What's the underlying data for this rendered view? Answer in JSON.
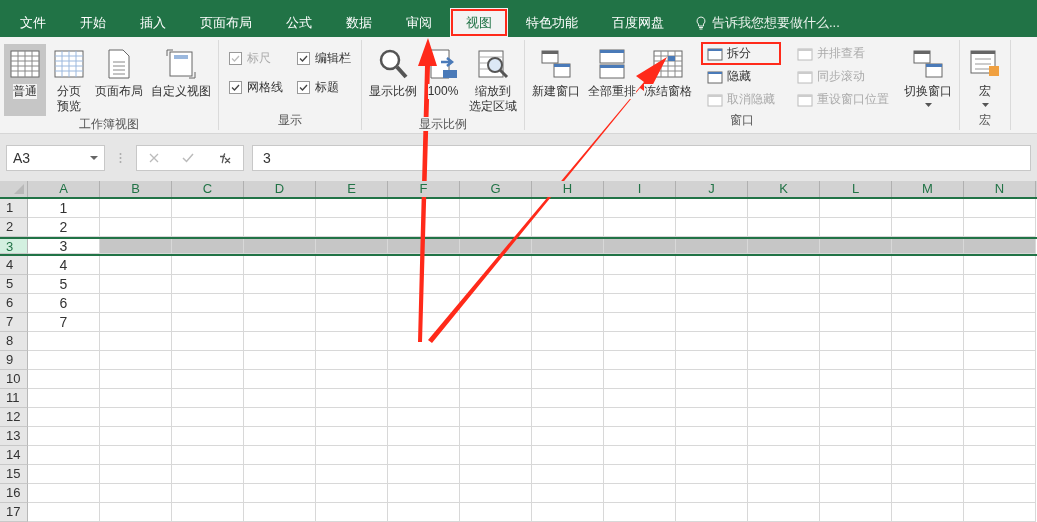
{
  "tabs": [
    {
      "label": "文件",
      "selected": false,
      "highlighted": false
    },
    {
      "label": "开始",
      "selected": false,
      "highlighted": false
    },
    {
      "label": "插入",
      "selected": false,
      "highlighted": false
    },
    {
      "label": "页面布局",
      "selected": false,
      "highlighted": false
    },
    {
      "label": "公式",
      "selected": false,
      "highlighted": false
    },
    {
      "label": "数据",
      "selected": false,
      "highlighted": false
    },
    {
      "label": "审阅",
      "selected": false,
      "highlighted": false
    },
    {
      "label": "视图",
      "selected": true,
      "highlighted": true
    },
    {
      "label": "特色功能",
      "selected": false,
      "highlighted": false
    },
    {
      "label": "百度网盘",
      "selected": false,
      "highlighted": false
    }
  ],
  "tell_me": {
    "placeholder": "告诉我您想要做什么..."
  },
  "ribbon_groups": [
    {
      "label": "工作簿视图",
      "columns": [
        {
          "kind": "large",
          "items": [
            {
              "label": "普通",
              "selected": true
            }
          ]
        },
        {
          "kind": "large",
          "items": [
            {
              "lines": [
                "分页",
                "预览"
              ],
              "selected": false
            }
          ]
        },
        {
          "kind": "large",
          "items": [
            {
              "label": "页面布局",
              "selected": false
            }
          ]
        },
        {
          "kind": "large",
          "items": [
            {
              "label": "自定义视图",
              "selected": false
            }
          ]
        }
      ]
    },
    {
      "label": "显示",
      "columns": [
        {
          "kind": "checks",
          "items": [
            {
              "label": "标尺",
              "checked": true,
              "disabled": true
            },
            {
              "label": "网格线",
              "checked": true,
              "disabled": false
            }
          ]
        },
        {
          "kind": "checks",
          "items": [
            {
              "label": "编辑栏",
              "checked": true,
              "disabled": false
            },
            {
              "label": "标题",
              "checked": true,
              "disabled": false
            }
          ]
        }
      ]
    },
    {
      "label": "显示比例",
      "columns": [
        {
          "kind": "large",
          "items": [
            {
              "label": "显示比例",
              "selected": false
            }
          ]
        },
        {
          "kind": "large",
          "items": [
            {
              "label": "100%",
              "selected": false
            }
          ]
        },
        {
          "kind": "large",
          "items": [
            {
              "lines": [
                "缩放到",
                "选定区域"
              ],
              "selected": false
            }
          ]
        }
      ]
    },
    {
      "label": "窗口",
      "columns": [
        {
          "kind": "large",
          "items": [
            {
              "label": "新建窗口",
              "selected": false
            }
          ]
        },
        {
          "kind": "large",
          "items": [
            {
              "label": "全部重排",
              "selected": false
            }
          ]
        },
        {
          "kind": "large",
          "items": [
            {
              "label": "冻结窗格",
              "selected": false
            }
          ]
        },
        {
          "kind": "small",
          "items": [
            {
              "label": "拆分",
              "disabled": false,
              "highlighted": true
            },
            {
              "label": "隐藏",
              "disabled": false,
              "highlighted": false
            },
            {
              "label": "取消隐藏",
              "disabled": true,
              "highlighted": false
            }
          ]
        },
        {
          "kind": "small",
          "items": [
            {
              "label": "并排查看",
              "disabled": true,
              "highlighted": false
            },
            {
              "label": "同步滚动",
              "disabled": true,
              "highlighted": false
            },
            {
              "label": "重设窗口位置",
              "disabled": true,
              "highlighted": false
            }
          ]
        },
        {
          "kind": "dropdown",
          "items": [
            {
              "label": "切换窗口",
              "selected": false
            }
          ]
        }
      ]
    },
    {
      "label": "宏",
      "columns": [
        {
          "kind": "dropdown",
          "items": [
            {
              "label": "宏",
              "selected": false
            }
          ]
        }
      ]
    }
  ],
  "formula_bar": {
    "name_box": "A3",
    "value": "3"
  },
  "columns": [
    "A",
    "B",
    "C",
    "D",
    "E",
    "F",
    "G",
    "H",
    "I",
    "J",
    "K",
    "L",
    "M",
    "N"
  ],
  "rows": [
    {
      "number": "1",
      "value": "1",
      "selected": false
    },
    {
      "number": "2",
      "value": "2",
      "selected": false
    },
    {
      "number": "3",
      "value": "3",
      "selected": true
    },
    {
      "number": "4",
      "value": "4",
      "selected": false
    },
    {
      "number": "5",
      "value": "5",
      "selected": false
    },
    {
      "number": "6",
      "value": "6",
      "selected": false
    },
    {
      "number": "7",
      "value": "7",
      "selected": false
    },
    {
      "number": "8",
      "selected": false
    },
    {
      "number": "9",
      "selected": false
    },
    {
      "number": "10",
      "selected": false
    },
    {
      "number": "11",
      "selected": false
    },
    {
      "number": "12",
      "selected": false
    },
    {
      "number": "13",
      "selected": false
    },
    {
      "number": "14",
      "selected": false
    },
    {
      "number": "15",
      "selected": false
    },
    {
      "number": "16",
      "selected": false
    },
    {
      "number": "17",
      "selected": false
    }
  ]
}
